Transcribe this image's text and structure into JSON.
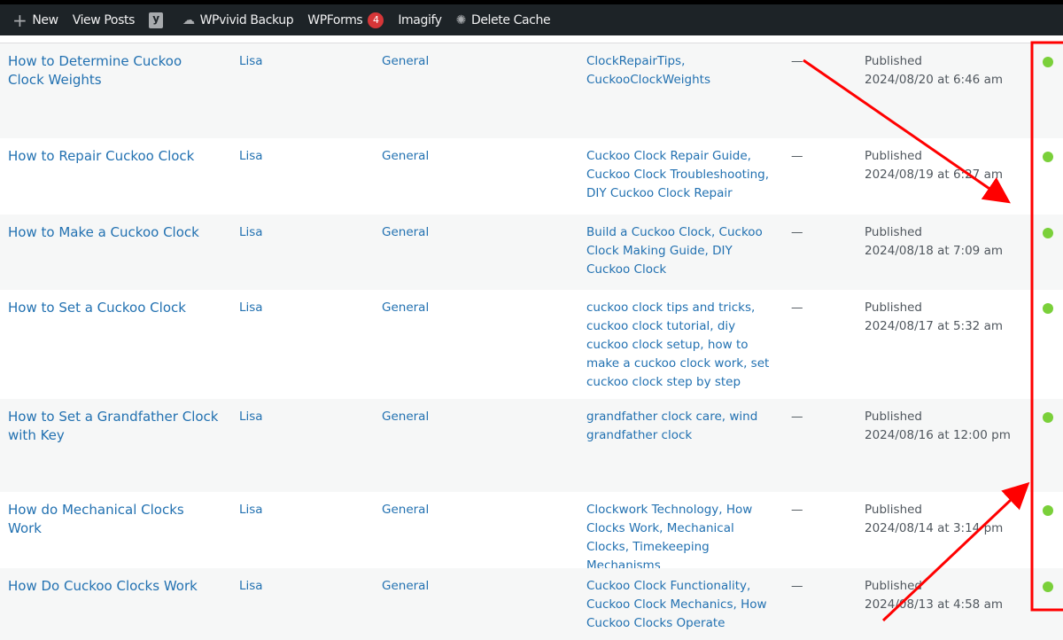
{
  "adminbar": {
    "new_label": "New",
    "view_posts": "View Posts",
    "wpvivid": "WPvivid Backup",
    "wpforms": "WPForms",
    "wpforms_badge": "4",
    "imagify": "Imagify",
    "delete_cache": "Delete Cache"
  },
  "posts": [
    {
      "title": "How to Determine Cuckoo Clock Weights",
      "author": "Lisa",
      "category": "General",
      "tags": "ClockRepairTips, CuckooClockWeights",
      "comments": "—",
      "status": "Published",
      "date": "2024/08/20 at 6:46 am"
    },
    {
      "title": "How to Repair Cuckoo Clock",
      "author": "Lisa",
      "category": "General",
      "tags": "Cuckoo Clock Repair Guide, Cuckoo Clock Troubleshooting, DIY Cuckoo Clock Repair",
      "comments": "—",
      "status": "Published",
      "date": "2024/08/19 at 6:27 am"
    },
    {
      "title": "How to Make a Cuckoo Clock",
      "author": "Lisa",
      "category": "General",
      "tags": "Build a Cuckoo Clock, Cuckoo Clock Making Guide, DIY Cuckoo Clock",
      "comments": "—",
      "status": "Published",
      "date": "2024/08/18 at 7:09 am"
    },
    {
      "title": "How to Set a Cuckoo Clock",
      "author": "Lisa",
      "category": "General",
      "tags": "cuckoo clock tips and tricks, cuckoo clock tutorial, diy cuckoo clock setup, how to make a cuckoo clock work, set cuckoo clock step by step",
      "comments": "—",
      "status": "Published",
      "date": "2024/08/17 at 5:32 am"
    },
    {
      "title": "How to Set a Grandfather Clock with Key",
      "author": "Lisa",
      "category": "General",
      "tags": "grandfather clock care, wind grandfather clock",
      "comments": "—",
      "status": "Published",
      "date": "2024/08/16 at 12:00 pm"
    },
    {
      "title": "How do Mechanical Clocks Work",
      "author": "Lisa",
      "category": "General",
      "tags": "Clockwork Technology, How Clocks Work, Mechanical Clocks, Timekeeping Mechanisms",
      "comments": "—",
      "status": "Published",
      "date": "2024/08/14 at 3:14 pm"
    },
    {
      "title": "How Do Cuckoo Clocks Work",
      "author": "Lisa",
      "category": "General",
      "tags": "Cuckoo Clock Functionality, Cuckoo Clock Mechanics, How Cuckoo Clocks Operate",
      "comments": "—",
      "status": "Published",
      "date": "2024/08/13 at 4:58 am"
    }
  ],
  "colors": {
    "status_dot": "#7ad03a",
    "annotation": "#ff0000",
    "link": "#2271b1"
  }
}
